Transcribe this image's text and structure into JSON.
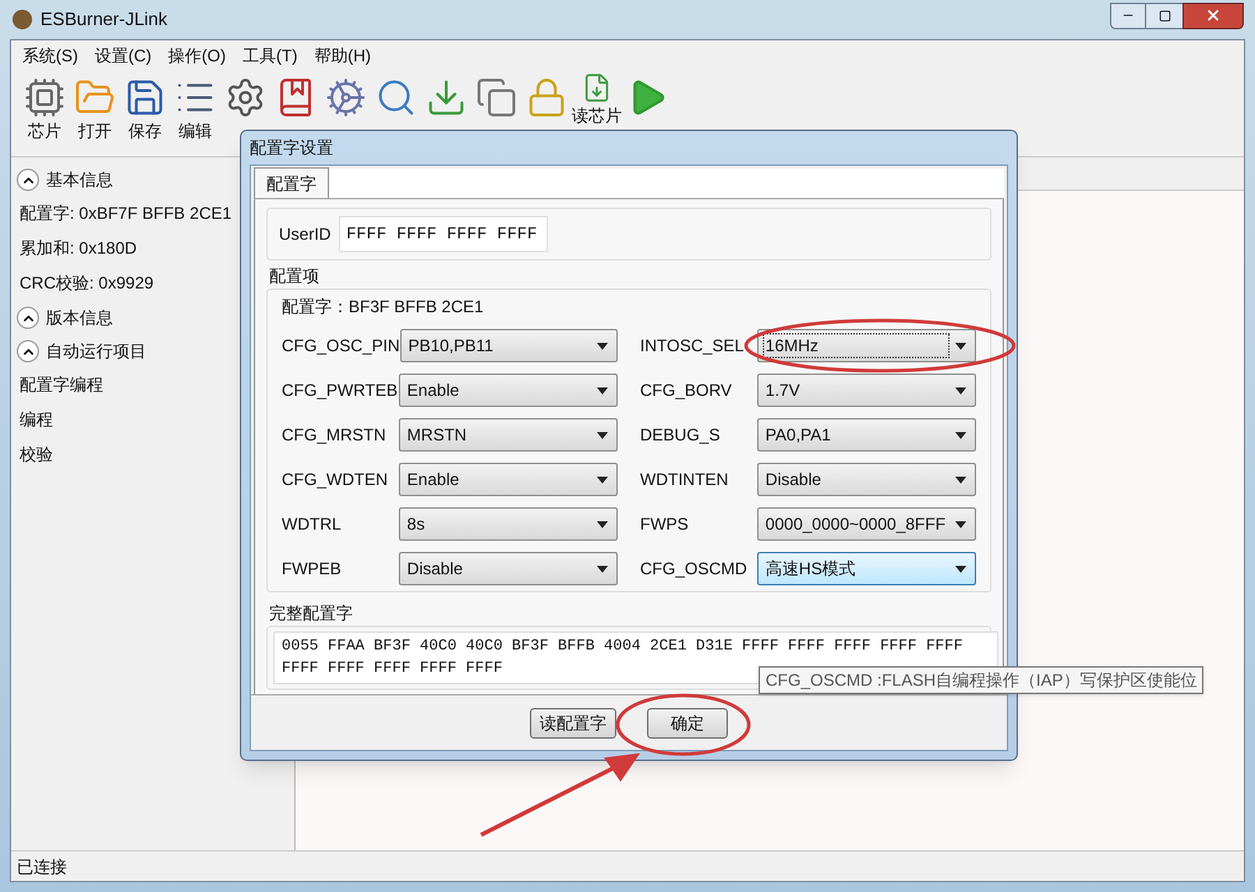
{
  "window": {
    "title": "ESBurner-JLink"
  },
  "menu": [
    "系统(S)",
    "设置(C)",
    "操作(O)",
    "工具(T)",
    "帮助(H)"
  ],
  "toolbar": [
    {
      "kind": "chip",
      "label": "芯片"
    },
    {
      "kind": "folder",
      "label": "打开"
    },
    {
      "kind": "save",
      "label": "保存"
    },
    {
      "kind": "list",
      "label": "编辑"
    },
    {
      "kind": "gear"
    },
    {
      "kind": "book"
    },
    {
      "kind": "cog"
    },
    {
      "kind": "search"
    },
    {
      "kind": "download"
    },
    {
      "kind": "windows"
    },
    {
      "kind": "lock"
    },
    {
      "kind": "read",
      "label": "读芯片"
    },
    {
      "kind": "play"
    }
  ],
  "sidebar": [
    {
      "kind": "section",
      "label": "基本信息",
      "expanded": true
    },
    {
      "kind": "item",
      "label": "配置字: 0xBF7F BFFB 2CE1"
    },
    {
      "kind": "item",
      "label": "累加和: 0x180D"
    },
    {
      "kind": "item",
      "label": "CRC校验: 0x9929"
    },
    {
      "kind": "section",
      "label": "版本信息",
      "expanded": true
    },
    {
      "kind": "section",
      "label": "自动运行项目",
      "expanded": true
    },
    {
      "kind": "item",
      "label": "配置字编程"
    },
    {
      "kind": "item",
      "label": "编程"
    },
    {
      "kind": "item",
      "label": "校验"
    }
  ],
  "dialog": {
    "title": "配置字设置",
    "tabs": [
      {
        "label": "配置字",
        "selected": true
      }
    ],
    "userid": {
      "label": "UserID",
      "value": "FFFF FFFF FFFF FFFF"
    },
    "options_group": {
      "title": "配置项",
      "config_word": "配置字：BF3F BFFB 2CE1",
      "fields": [
        {
          "label": "CFG_OSC_PIN",
          "value": "PB10,PB11",
          "focused": false,
          "hovered": false
        },
        {
          "label": "INTOSC_SEL",
          "value": "16MHz",
          "focused": true,
          "hovered": false
        },
        {
          "label": "CFG_PWRTEB",
          "value": "Enable",
          "focused": false,
          "hovered": false
        },
        {
          "label": "CFG_BORV",
          "value": "1.7V",
          "focused": false,
          "hovered": false
        },
        {
          "label": "CFG_MRSTN",
          "value": "MRSTN",
          "focused": false,
          "hovered": false
        },
        {
          "label": "DEBUG_S",
          "value": "PA0,PA1",
          "focused": false,
          "hovered": false
        },
        {
          "label": "CFG_WDTEN",
          "value": "Enable",
          "focused": false,
          "hovered": false
        },
        {
          "label": "WDTINTEN",
          "value": "Disable",
          "focused": false,
          "hovered": false
        },
        {
          "label": "WDTRL",
          "value": "8s",
          "focused": false,
          "hovered": false
        },
        {
          "label": "FWPS",
          "value": "0000_0000~0000_8FFF",
          "focused": false,
          "hovered": false
        },
        {
          "label": "FWPEB",
          "value": "Disable",
          "focused": false,
          "hovered": false
        },
        {
          "label": "CFG_OSCMD",
          "value": "高速HS模式",
          "focused": false,
          "hovered": true
        }
      ]
    },
    "tooltip": "CFG_OSCMD :FLASH自编程操作（IAP）写保护区使能位",
    "full_group": {
      "title": "完整配置字",
      "value": "0055 FFAA BF3F 40C0 40C0 BF3F BFFB 4004 2CE1 D31E FFFF FFFF FFFF FFFF FFFF FFFF FFFF FFFF FFFF FFFF"
    },
    "buttons": [
      {
        "label": "读配置字"
      },
      {
        "label": "确定"
      }
    ]
  },
  "status_bar": "已连接"
}
